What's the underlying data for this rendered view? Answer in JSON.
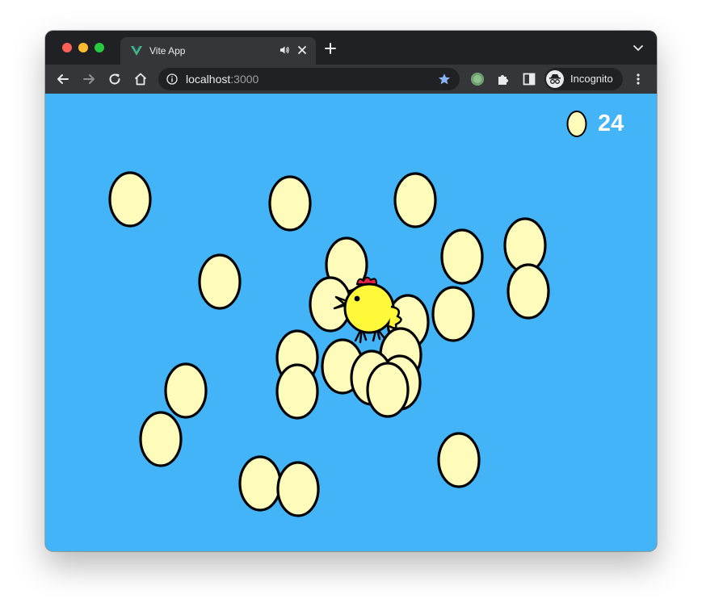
{
  "browser": {
    "tab": {
      "title": "Vite App",
      "favicon": "vue-logo-icon",
      "audio_icon": "speaker-icon",
      "close_icon": "close-icon"
    },
    "new_tab_icon": "plus-icon",
    "tab_menu_icon": "chevron-down-icon",
    "nav": {
      "back": "back-arrow-icon",
      "forward": "forward-arrow-icon",
      "reload": "reload-icon",
      "home": "home-icon"
    },
    "address": {
      "host": "localhost",
      "port": ":3000",
      "info_icon": "info-icon",
      "bookmark_icon": "star-icon"
    },
    "extensions": [
      "extension-circle-icon",
      "puzzle-icon",
      "sidebar-icon"
    ],
    "profile": {
      "label": "Incognito",
      "icon": "incognito-icon"
    },
    "menu_icon": "kebab-menu-icon"
  },
  "game": {
    "score": {
      "count": "24",
      "icon": "egg-icon"
    },
    "colors": {
      "sky": "#42b4f7",
      "egg_fill": "#fffbbb",
      "outline": "#000000",
      "chicken_body": "#fff93a",
      "comb": "#e8204a"
    },
    "chicken": {
      "icon": "chicken-icon"
    }
  }
}
